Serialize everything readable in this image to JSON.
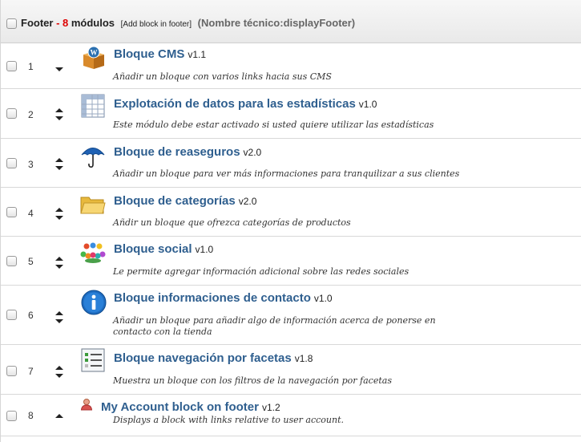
{
  "hook": {
    "name": "Footer",
    "separator": " - ",
    "count": "8",
    "count_suffix": " módulos",
    "add_block": "[Add block in footer]",
    "technical_name": "(Nombre técnico:displayFooter)"
  },
  "modules": [
    {
      "position": "1",
      "title": "Bloque CMS",
      "version": "v1.1",
      "description": "Añadir un bloque con varios links hacia sus CMS",
      "icon": "cms-box-icon"
    },
    {
      "position": "2",
      "title": "Explotación de datos para las estadísticas",
      "version": "v1.0",
      "description": "Este módulo debe estar activado si usted quiere utilizar las estadísticas",
      "icon": "spreadsheet-icon"
    },
    {
      "position": "3",
      "title": "Bloque de reaseguros",
      "version": "v2.0",
      "description": "Añadir un bloque para ver más informaciones para tranquilizar a sus clientes",
      "icon": "umbrella-icon"
    },
    {
      "position": "4",
      "title": "Bloque de categorías",
      "version": "v2.0",
      "description": "Añdir un bloque que ofrezca categorías de productos",
      "icon": "folder-icon"
    },
    {
      "position": "5",
      "title": "Bloque social",
      "version": "v1.0",
      "description": "Le permite agregar información adicional sobre las redes sociales",
      "icon": "social-people-icon"
    },
    {
      "position": "6",
      "title": "Bloque informaciones de contacto",
      "version": "v1.0",
      "description": "Añadir un bloque para añadir algo de información acerca de ponerse en contacto con la tienda",
      "icon": "info-icon"
    },
    {
      "position": "7",
      "title": "Bloque navegación por facetas",
      "version": "v1.8",
      "description": "Muestra un bloque con los filtros de la navegación por facetas",
      "icon": "faceted-list-icon"
    },
    {
      "position": "8",
      "title": "My Account block on footer",
      "version": "v1.2",
      "description": "Displays a block with links relative to user account.",
      "icon": "user-icon"
    }
  ]
}
